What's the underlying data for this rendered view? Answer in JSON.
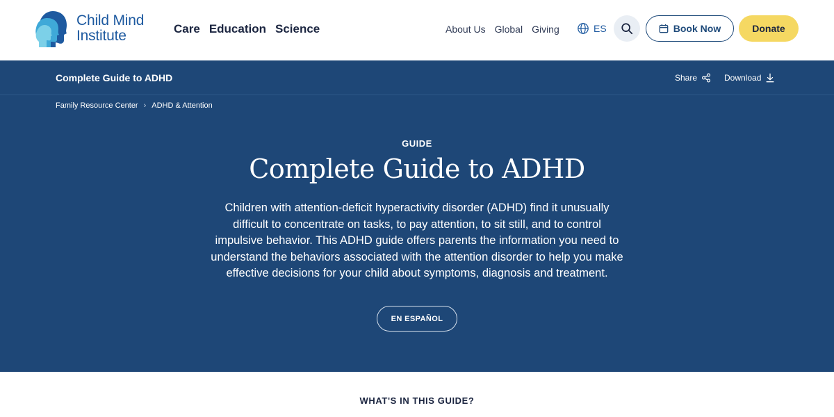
{
  "header": {
    "logo": {
      "line1": "Child Mind",
      "line2": "Institute"
    },
    "main_nav": [
      {
        "label": "Care"
      },
      {
        "label": "Education"
      },
      {
        "label": "Science"
      }
    ],
    "utility_nav": [
      {
        "label": "About Us"
      },
      {
        "label": "Global"
      },
      {
        "label": "Giving"
      }
    ],
    "language_label": "ES",
    "book_now_label": "Book Now",
    "donate_label": "Donate",
    "icons": {
      "language": "globe-icon",
      "search": "search-icon",
      "book": "calendar-icon"
    }
  },
  "subbar": {
    "title": "Complete Guide to ADHD",
    "share_label": "Share",
    "download_label": "Download"
  },
  "breadcrumb": [
    "Family Resource Center",
    "ADHD & Attention"
  ],
  "hero": {
    "eyebrow": "GUIDE",
    "title": "Complete Guide to ADHD",
    "description": "Children with attention-deficit hyperactivity disorder (ADHD) find it unusually difficult to concentrate on tasks, to pay attention, to sit still, and to control impulsive behavior. This ADHD guide offers parents the information you need to understand the behaviors associated with the attention disorder to help you make effective decisions for your child about symptoms, diagnosis and treatment.",
    "language_button": "EN ESPAÑOL"
  },
  "toc": {
    "title": "WHAT'S IN THIS GUIDE?"
  },
  "colors": {
    "hero_bg": "#1e4777",
    "brand_blue": "#1e5aa0",
    "donate_yellow": "#f5d862",
    "search_bg": "#e9eef4"
  }
}
